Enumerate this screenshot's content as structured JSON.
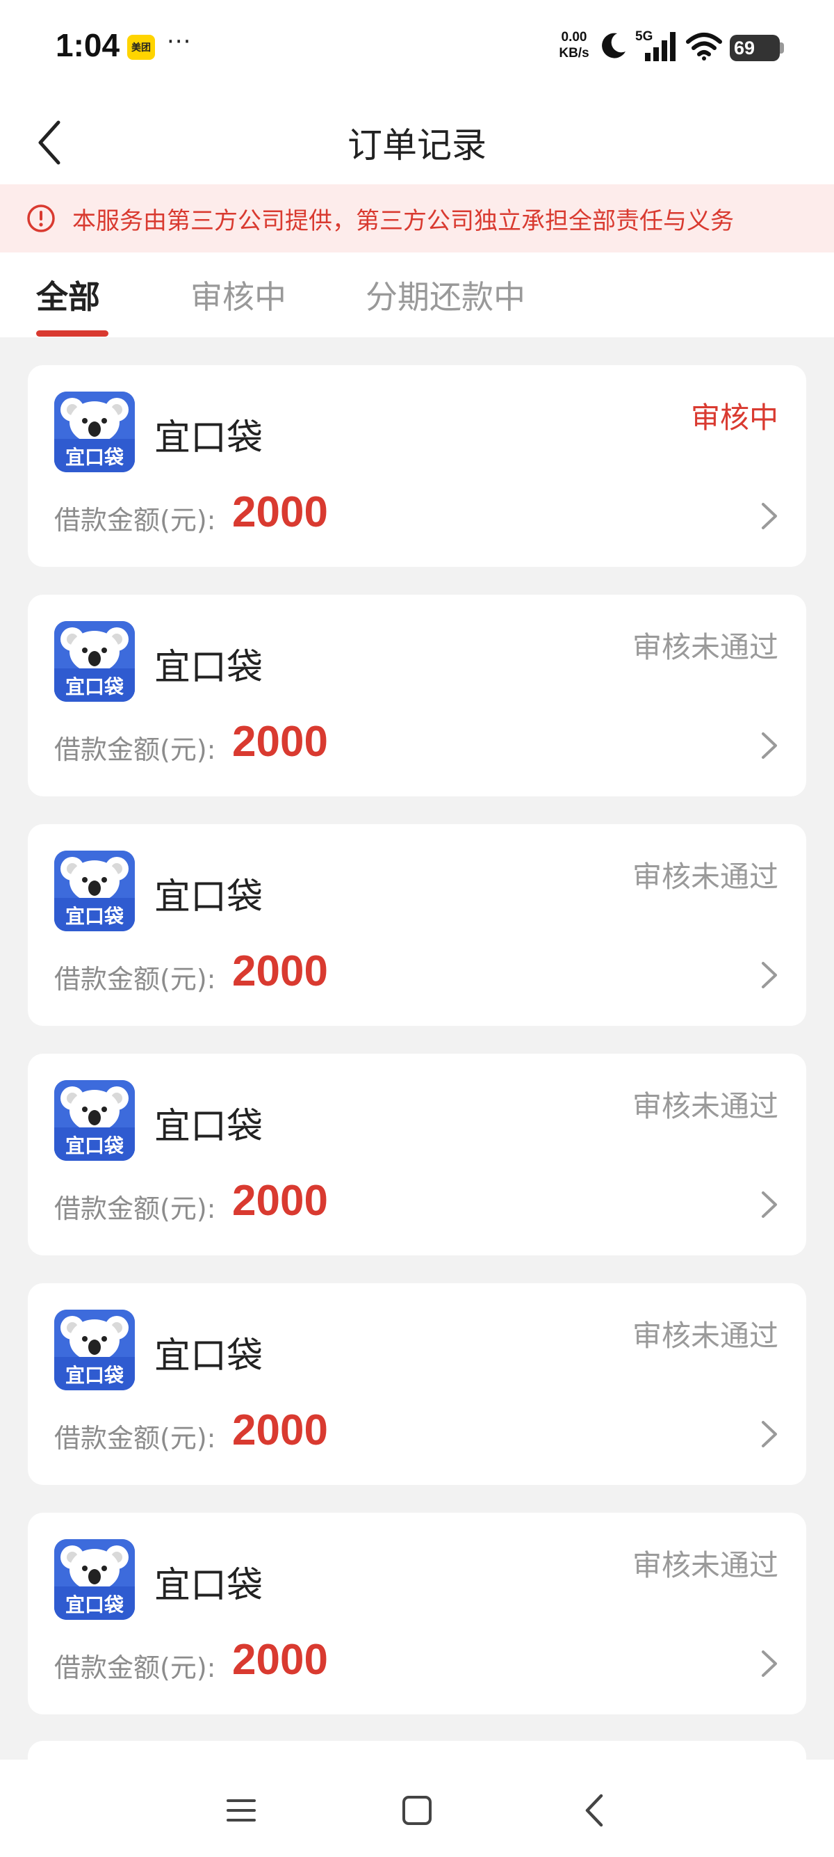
{
  "status_bar": {
    "time": "1:04",
    "app_badge": "美团",
    "more": "···",
    "speed_value": "0.00",
    "speed_unit": "KB/s",
    "network": "5G",
    "battery": "69"
  },
  "header": {
    "title": "订单记录"
  },
  "notice": {
    "text": "本服务由第三方公司提供，第三方公司独立承担全部责任与义务"
  },
  "tabs": [
    {
      "label": "全部",
      "active": true
    },
    {
      "label": "审核中",
      "active": false
    },
    {
      "label": "分期还款中",
      "active": false
    }
  ],
  "orders": [
    {
      "logo_text": "宜口袋",
      "name": "宜口袋",
      "status": "审核中",
      "status_color": "#d93a30",
      "amount_label": "借款金额(元):",
      "amount": "2000"
    },
    {
      "logo_text": "宜口袋",
      "name": "宜口袋",
      "status": "审核未通过",
      "status_color": "#9a9a9a",
      "amount_label": "借款金额(元):",
      "amount": "2000"
    },
    {
      "logo_text": "宜口袋",
      "name": "宜口袋",
      "status": "审核未通过",
      "status_color": "#9a9a9a",
      "amount_label": "借款金额(元):",
      "amount": "2000"
    },
    {
      "logo_text": "宜口袋",
      "name": "宜口袋",
      "status": "审核未通过",
      "status_color": "#9a9a9a",
      "amount_label": "借款金额(元):",
      "amount": "2000"
    },
    {
      "logo_text": "宜口袋",
      "name": "宜口袋",
      "status": "审核未通过",
      "status_color": "#9a9a9a",
      "amount_label": "借款金额(元):",
      "amount": "2000"
    },
    {
      "logo_text": "宜口袋",
      "name": "宜口袋",
      "status": "审核未通过",
      "status_color": "#9a9a9a",
      "amount_label": "借款金额(元):",
      "amount": "2000"
    }
  ],
  "colors": {
    "accent": "#d93a30",
    "logo_blue": "#3d6bdc",
    "notice_bg": "#fdeceb"
  },
  "icons": {
    "back": "chevron-left-icon",
    "notice": "alert-circle-icon",
    "row_arrow": "chevron-right-icon",
    "nav_menu": "menu-icon",
    "nav_home": "square-home-icon",
    "nav_back": "back-icon"
  }
}
